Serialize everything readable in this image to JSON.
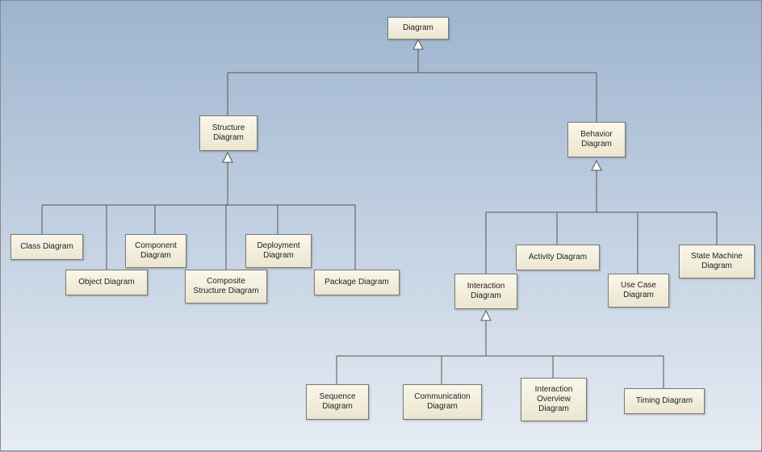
{
  "nodes": {
    "root": {
      "label": "Diagram"
    },
    "structure": {
      "label": "Structure\nDiagram"
    },
    "behavior": {
      "label": "Behavior\nDiagram"
    },
    "class": {
      "label": "Class Diagram"
    },
    "object": {
      "label": "Object Diagram"
    },
    "component": {
      "label": "Component\nDiagram"
    },
    "composite": {
      "label": "Composite\nStructure Diagram"
    },
    "deployment": {
      "label": "Deployment\nDiagram"
    },
    "package": {
      "label": "Package Diagram"
    },
    "activity": {
      "label": "Activity Diagram"
    },
    "usecase": {
      "label": "Use Case\nDiagram"
    },
    "statemachine": {
      "label": "State Machine\nDiagram"
    },
    "interaction": {
      "label": "Interaction\nDiagram"
    },
    "sequence": {
      "label": "Sequence\nDiagram"
    },
    "communication": {
      "label": "Communication\nDiagram"
    },
    "intoverview": {
      "label": "Interaction\nOverview\nDiagram"
    },
    "timing": {
      "label": "Timing Diagram"
    }
  }
}
